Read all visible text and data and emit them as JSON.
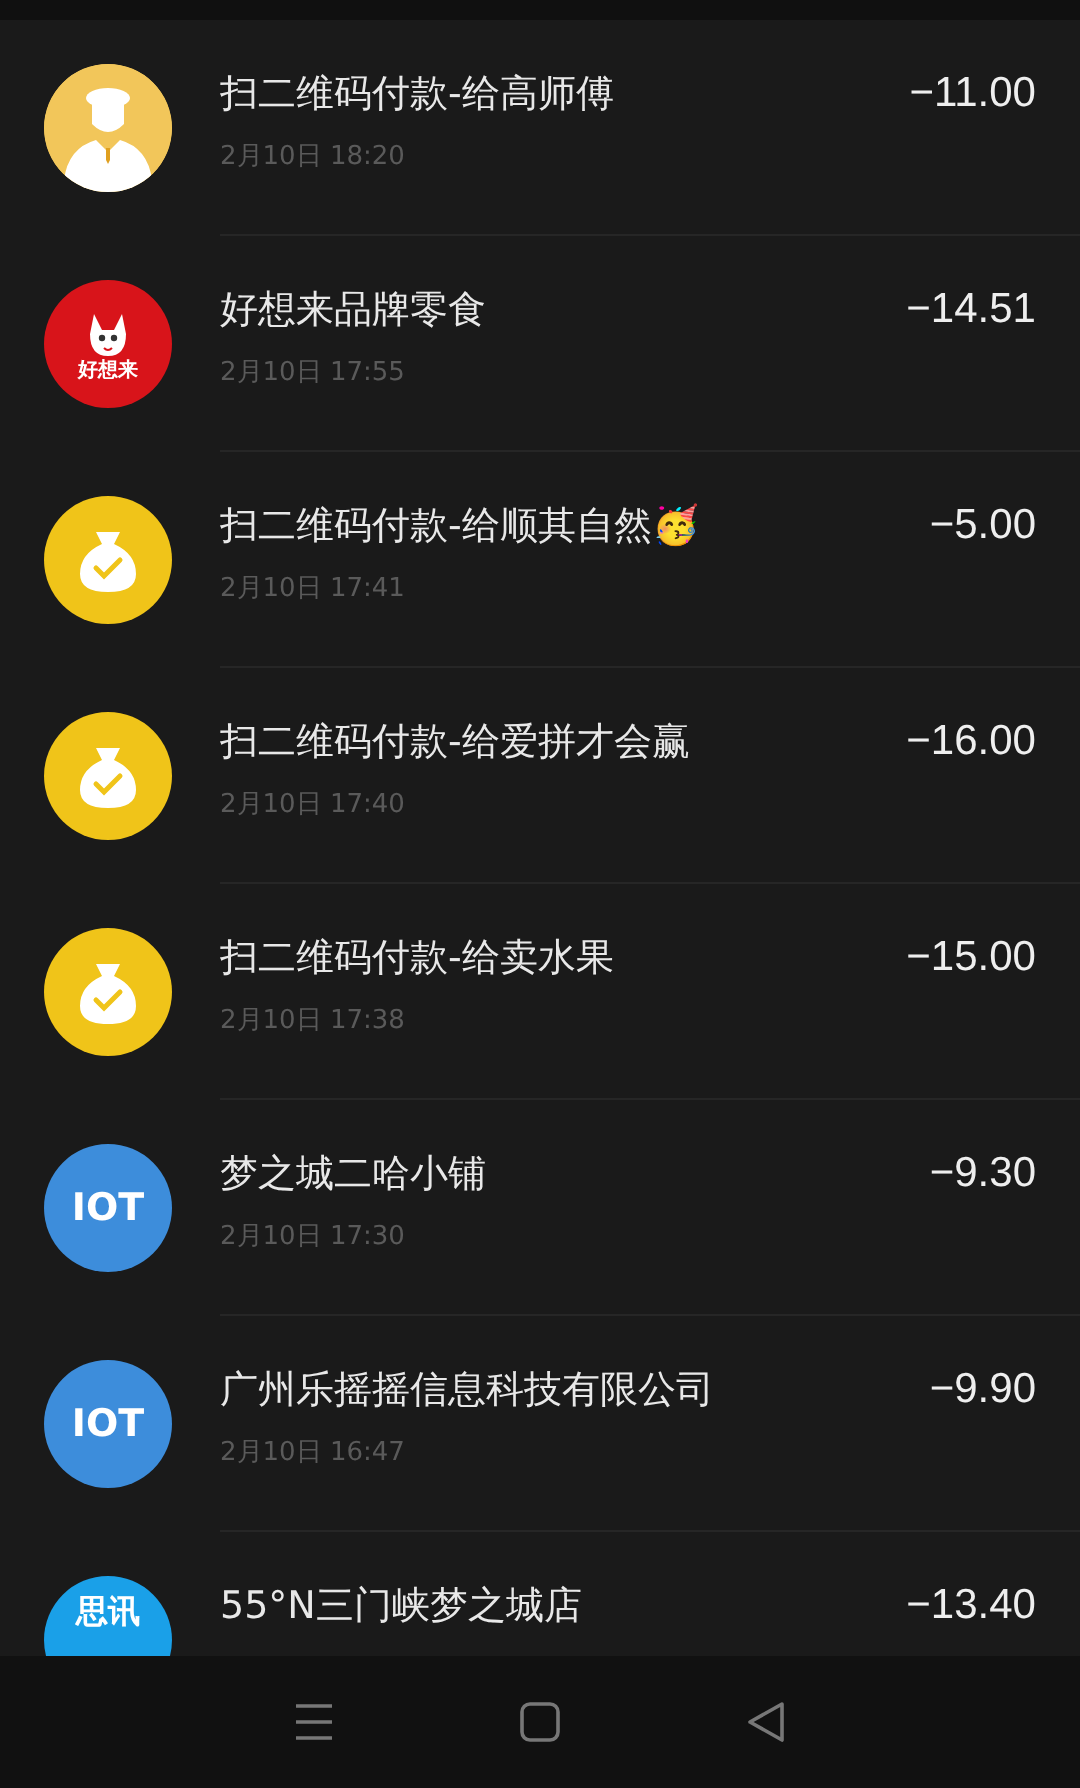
{
  "transactions": [
    {
      "avatar": {
        "kind": "person"
      },
      "title": "扫二维码付款-给高师傅",
      "date": "2月10日 18:20",
      "amount": "−11.00"
    },
    {
      "avatar": {
        "kind": "brand",
        "text": "好想来"
      },
      "title": "好想来品牌零食",
      "date": "2月10日 17:55",
      "amount": "−14.51"
    },
    {
      "avatar": {
        "kind": "moneybag"
      },
      "title": "扫二维码付款-给顺其自然🥳",
      "date": "2月10日 17:41",
      "amount": "−5.00"
    },
    {
      "avatar": {
        "kind": "moneybag"
      },
      "title": "扫二维码付款-给爱拼才会赢",
      "date": "2月10日 17:40",
      "amount": "−16.00"
    },
    {
      "avatar": {
        "kind": "moneybag"
      },
      "title": "扫二维码付款-给卖水果",
      "date": "2月10日 17:38",
      "amount": "−15.00"
    },
    {
      "avatar": {
        "kind": "iot",
        "text": "IOT"
      },
      "title": "梦之城二哈小铺",
      "date": "2月10日 17:30",
      "amount": "−9.30"
    },
    {
      "avatar": {
        "kind": "iot",
        "text": "IOT"
      },
      "title": "广州乐摇摇信息科技有限公司",
      "date": "2月10日 16:47",
      "amount": "−9.90"
    },
    {
      "avatar": {
        "kind": "sixun",
        "text": "思讯"
      },
      "title": "55°N三门峡梦之城店",
      "amount": "−13.40"
    }
  ],
  "nav_bar": {
    "buttons": [
      {
        "kind": "menu"
      },
      {
        "kind": "home"
      },
      {
        "kind": "back"
      }
    ]
  }
}
